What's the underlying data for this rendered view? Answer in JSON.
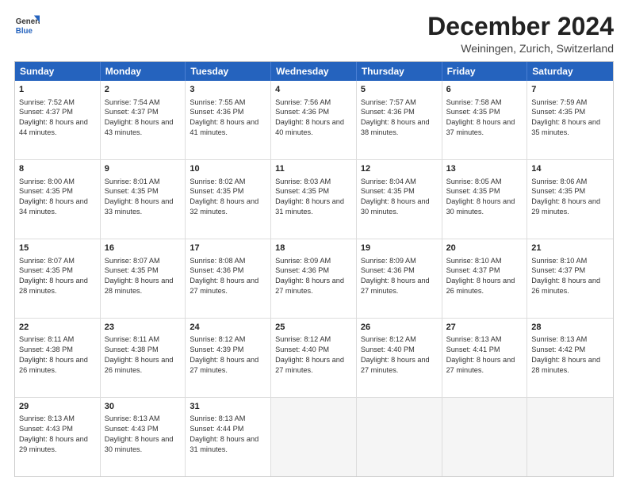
{
  "logo": {
    "line1": "General",
    "line2": "Blue"
  },
  "title": "December 2024",
  "subtitle": "Weiningen, Zurich, Switzerland",
  "header_days": [
    "Sunday",
    "Monday",
    "Tuesday",
    "Wednesday",
    "Thursday",
    "Friday",
    "Saturday"
  ],
  "weeks": [
    [
      {
        "day": "1",
        "sunrise": "Sunrise: 7:52 AM",
        "sunset": "Sunset: 4:37 PM",
        "daylight": "Daylight: 8 hours and 44 minutes.",
        "empty": false
      },
      {
        "day": "2",
        "sunrise": "Sunrise: 7:54 AM",
        "sunset": "Sunset: 4:37 PM",
        "daylight": "Daylight: 8 hours and 43 minutes.",
        "empty": false
      },
      {
        "day": "3",
        "sunrise": "Sunrise: 7:55 AM",
        "sunset": "Sunset: 4:36 PM",
        "daylight": "Daylight: 8 hours and 41 minutes.",
        "empty": false
      },
      {
        "day": "4",
        "sunrise": "Sunrise: 7:56 AM",
        "sunset": "Sunset: 4:36 PM",
        "daylight": "Daylight: 8 hours and 40 minutes.",
        "empty": false
      },
      {
        "day": "5",
        "sunrise": "Sunrise: 7:57 AM",
        "sunset": "Sunset: 4:36 PM",
        "daylight": "Daylight: 8 hours and 38 minutes.",
        "empty": false
      },
      {
        "day": "6",
        "sunrise": "Sunrise: 7:58 AM",
        "sunset": "Sunset: 4:35 PM",
        "daylight": "Daylight: 8 hours and 37 minutes.",
        "empty": false
      },
      {
        "day": "7",
        "sunrise": "Sunrise: 7:59 AM",
        "sunset": "Sunset: 4:35 PM",
        "daylight": "Daylight: 8 hours and 35 minutes.",
        "empty": false
      }
    ],
    [
      {
        "day": "8",
        "sunrise": "Sunrise: 8:00 AM",
        "sunset": "Sunset: 4:35 PM",
        "daylight": "Daylight: 8 hours and 34 minutes.",
        "empty": false
      },
      {
        "day": "9",
        "sunrise": "Sunrise: 8:01 AM",
        "sunset": "Sunset: 4:35 PM",
        "daylight": "Daylight: 8 hours and 33 minutes.",
        "empty": false
      },
      {
        "day": "10",
        "sunrise": "Sunrise: 8:02 AM",
        "sunset": "Sunset: 4:35 PM",
        "daylight": "Daylight: 8 hours and 32 minutes.",
        "empty": false
      },
      {
        "day": "11",
        "sunrise": "Sunrise: 8:03 AM",
        "sunset": "Sunset: 4:35 PM",
        "daylight": "Daylight: 8 hours and 31 minutes.",
        "empty": false
      },
      {
        "day": "12",
        "sunrise": "Sunrise: 8:04 AM",
        "sunset": "Sunset: 4:35 PM",
        "daylight": "Daylight: 8 hours and 30 minutes.",
        "empty": false
      },
      {
        "day": "13",
        "sunrise": "Sunrise: 8:05 AM",
        "sunset": "Sunset: 4:35 PM",
        "daylight": "Daylight: 8 hours and 30 minutes.",
        "empty": false
      },
      {
        "day": "14",
        "sunrise": "Sunrise: 8:06 AM",
        "sunset": "Sunset: 4:35 PM",
        "daylight": "Daylight: 8 hours and 29 minutes.",
        "empty": false
      }
    ],
    [
      {
        "day": "15",
        "sunrise": "Sunrise: 8:07 AM",
        "sunset": "Sunset: 4:35 PM",
        "daylight": "Daylight: 8 hours and 28 minutes.",
        "empty": false
      },
      {
        "day": "16",
        "sunrise": "Sunrise: 8:07 AM",
        "sunset": "Sunset: 4:35 PM",
        "daylight": "Daylight: 8 hours and 28 minutes.",
        "empty": false
      },
      {
        "day": "17",
        "sunrise": "Sunrise: 8:08 AM",
        "sunset": "Sunset: 4:36 PM",
        "daylight": "Daylight: 8 hours and 27 minutes.",
        "empty": false
      },
      {
        "day": "18",
        "sunrise": "Sunrise: 8:09 AM",
        "sunset": "Sunset: 4:36 PM",
        "daylight": "Daylight: 8 hours and 27 minutes.",
        "empty": false
      },
      {
        "day": "19",
        "sunrise": "Sunrise: 8:09 AM",
        "sunset": "Sunset: 4:36 PM",
        "daylight": "Daylight: 8 hours and 27 minutes.",
        "empty": false
      },
      {
        "day": "20",
        "sunrise": "Sunrise: 8:10 AM",
        "sunset": "Sunset: 4:37 PM",
        "daylight": "Daylight: 8 hours and 26 minutes.",
        "empty": false
      },
      {
        "day": "21",
        "sunrise": "Sunrise: 8:10 AM",
        "sunset": "Sunset: 4:37 PM",
        "daylight": "Daylight: 8 hours and 26 minutes.",
        "empty": false
      }
    ],
    [
      {
        "day": "22",
        "sunrise": "Sunrise: 8:11 AM",
        "sunset": "Sunset: 4:38 PM",
        "daylight": "Daylight: 8 hours and 26 minutes.",
        "empty": false
      },
      {
        "day": "23",
        "sunrise": "Sunrise: 8:11 AM",
        "sunset": "Sunset: 4:38 PM",
        "daylight": "Daylight: 8 hours and 26 minutes.",
        "empty": false
      },
      {
        "day": "24",
        "sunrise": "Sunrise: 8:12 AM",
        "sunset": "Sunset: 4:39 PM",
        "daylight": "Daylight: 8 hours and 27 minutes.",
        "empty": false
      },
      {
        "day": "25",
        "sunrise": "Sunrise: 8:12 AM",
        "sunset": "Sunset: 4:40 PM",
        "daylight": "Daylight: 8 hours and 27 minutes.",
        "empty": false
      },
      {
        "day": "26",
        "sunrise": "Sunrise: 8:12 AM",
        "sunset": "Sunset: 4:40 PM",
        "daylight": "Daylight: 8 hours and 27 minutes.",
        "empty": false
      },
      {
        "day": "27",
        "sunrise": "Sunrise: 8:13 AM",
        "sunset": "Sunset: 4:41 PM",
        "daylight": "Daylight: 8 hours and 27 minutes.",
        "empty": false
      },
      {
        "day": "28",
        "sunrise": "Sunrise: 8:13 AM",
        "sunset": "Sunset: 4:42 PM",
        "daylight": "Daylight: 8 hours and 28 minutes.",
        "empty": false
      }
    ],
    [
      {
        "day": "29",
        "sunrise": "Sunrise: 8:13 AM",
        "sunset": "Sunset: 4:43 PM",
        "daylight": "Daylight: 8 hours and 29 minutes.",
        "empty": false
      },
      {
        "day": "30",
        "sunrise": "Sunrise: 8:13 AM",
        "sunset": "Sunset: 4:43 PM",
        "daylight": "Daylight: 8 hours and 30 minutes.",
        "empty": false
      },
      {
        "day": "31",
        "sunrise": "Sunrise: 8:13 AM",
        "sunset": "Sunset: 4:44 PM",
        "daylight": "Daylight: 8 hours and 31 minutes.",
        "empty": false
      },
      {
        "day": "",
        "sunrise": "",
        "sunset": "",
        "daylight": "",
        "empty": true
      },
      {
        "day": "",
        "sunrise": "",
        "sunset": "",
        "daylight": "",
        "empty": true
      },
      {
        "day": "",
        "sunrise": "",
        "sunset": "",
        "daylight": "",
        "empty": true
      },
      {
        "day": "",
        "sunrise": "",
        "sunset": "",
        "daylight": "",
        "empty": true
      }
    ]
  ]
}
